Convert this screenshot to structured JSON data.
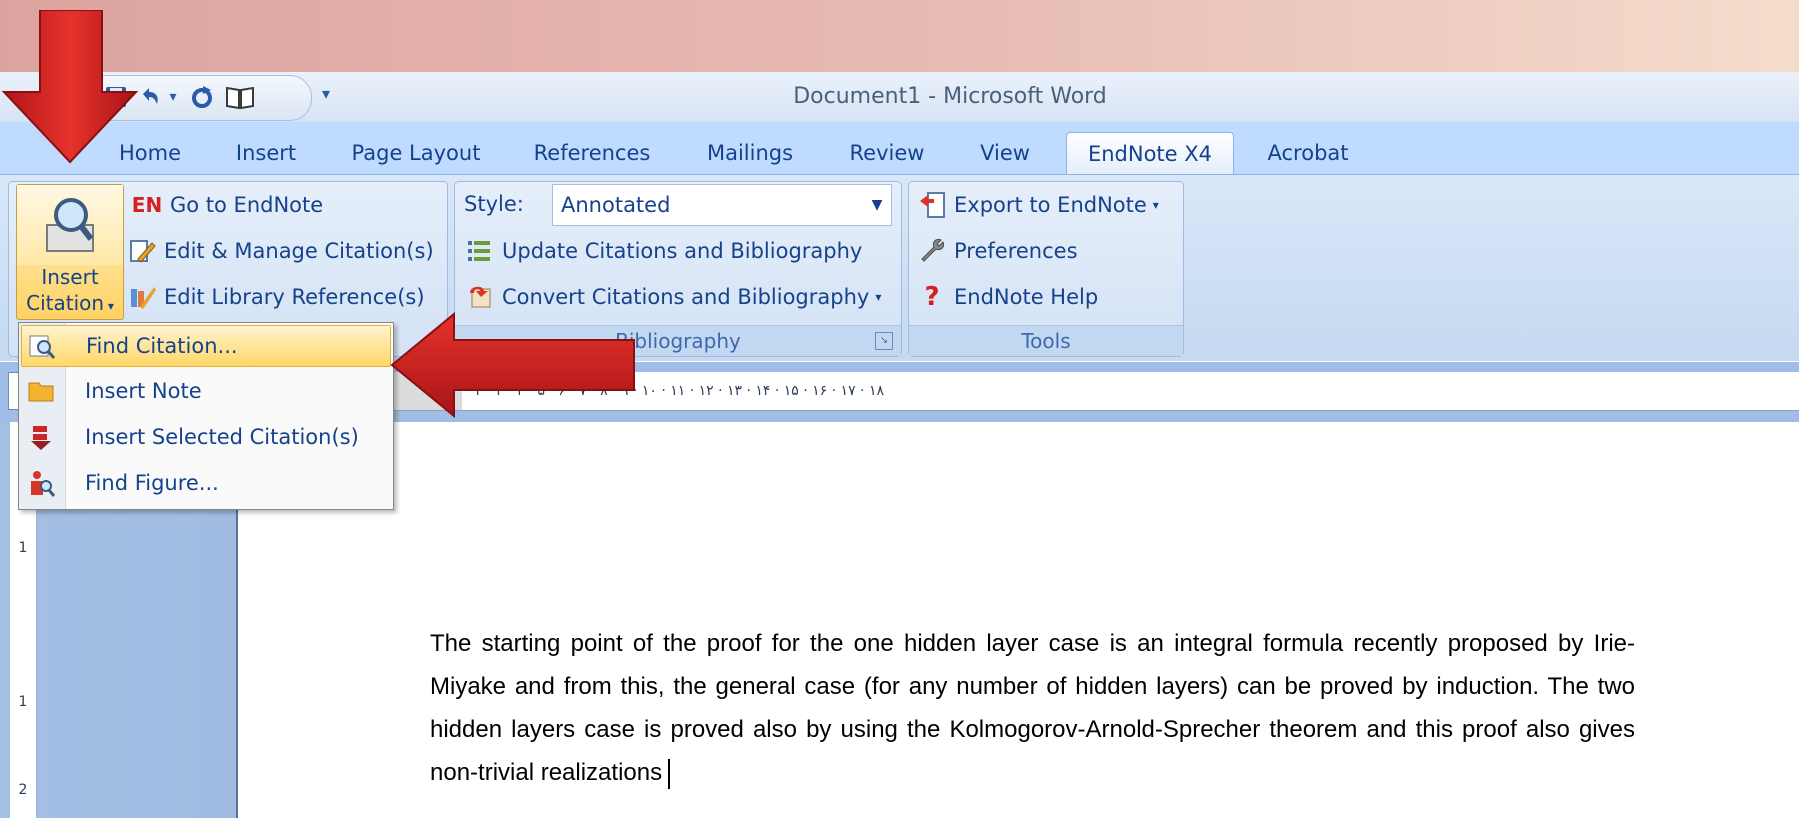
{
  "window": {
    "title": "Document1 - Microsoft Word"
  },
  "quick_access": {
    "icons": [
      "save-icon",
      "undo-icon",
      "redo-icon",
      "print-preview-icon",
      "customize-qat-icon"
    ],
    "undo_dropdown": "▾",
    "customize_glyph": "▾"
  },
  "tabs": [
    {
      "label": "Home"
    },
    {
      "label": "Insert"
    },
    {
      "label": "Page Layout"
    },
    {
      "label": "References"
    },
    {
      "label": "Mailings"
    },
    {
      "label": "Review"
    },
    {
      "label": "View"
    },
    {
      "label": "EndNote X4",
      "active": true
    },
    {
      "label": "Acrobat"
    }
  ],
  "ribbon": {
    "citations": {
      "insert_citation_line1": "Insert",
      "insert_citation_line2": "Citation",
      "go_to_endnote_prefix": "EN",
      "go_to_endnote": "Go to EndNote",
      "edit_manage": "Edit & Manage Citation(s)",
      "edit_library": "Edit Library Reference(s)"
    },
    "bibliography": {
      "style_label": "Style:",
      "style_value": "Annotated",
      "update": "Update Citations and Bibliography",
      "convert": "Convert Citations and Bibliography",
      "group_label": "Bibliography"
    },
    "tools": {
      "export": "Export to EndNote",
      "preferences": "Preferences",
      "help": "EndNote Help",
      "group_label": "Tools"
    }
  },
  "menu": {
    "items": [
      {
        "label": "Find Citation...",
        "icon": "find-citation-icon",
        "highlighted": true
      },
      {
        "label": "Insert Note",
        "icon": "insert-note-icon"
      },
      {
        "label": "Insert Selected Citation(s)",
        "icon": "insert-selected-citation-icon"
      },
      {
        "label": "Find Figure...",
        "icon": "find-figure-icon"
      }
    ]
  },
  "ruler": {
    "ticks": "۱ · ۲ · ۳ · ۴ · ۵ · ۶ · ۷ · ۸ · ۹ · ۱۰ · ۱۱ · ۱۲ · ۱۳ · ۱۴ · ۱۵ · ۱۶ · ۱۷ · ۱۸",
    "vertical_ticks": [
      "1",
      "2"
    ]
  },
  "document": {
    "paragraph": "The starting point of the proof for the one hidden layer case is an integral formula recently proposed by Irie-Miyake and from this, the general case (for any number of hidden layers) can be proved by induction. The two hidden layers case is proved also by using the Kolmogorov-Arnold-Sprecher theorem and this proof also gives non-trivial realizations"
  },
  "colors": {
    "ribbon_blue": "#bfdbff",
    "highlight": "#ffd767",
    "arrow_red": "#d9241c"
  }
}
